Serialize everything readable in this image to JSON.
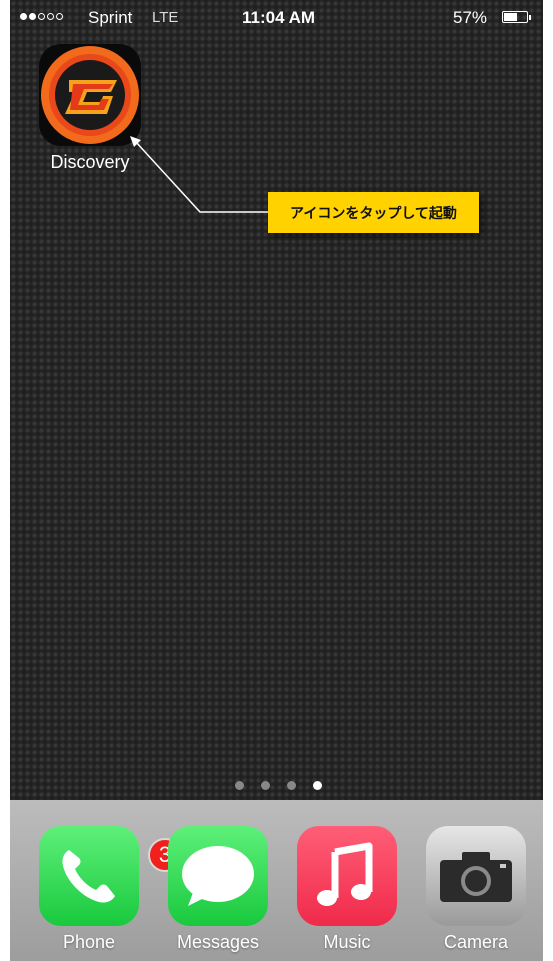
{
  "status_bar": {
    "signal_bars_filled": 2,
    "signal_bars_total": 5,
    "carrier": "Sprint",
    "network": "LTE",
    "time": "11:04 AM",
    "battery_percent_label": "57%",
    "battery_level": 0.57
  },
  "home": {
    "apps": [
      {
        "label": "Discovery",
        "icon": "discovery-app-icon"
      }
    ]
  },
  "callout": {
    "text": "アイコンをタップして起動",
    "background_color": "#ffd200"
  },
  "page_indicator": {
    "page_count": 4,
    "current_page": 4
  },
  "dock": {
    "apps": [
      {
        "label": "Phone",
        "icon": "phone-icon",
        "badge": "3"
      },
      {
        "label": "Messages",
        "icon": "messages-icon"
      },
      {
        "label": "Music",
        "icon": "music-note-icon"
      },
      {
        "label": "Camera",
        "icon": "camera-icon"
      }
    ]
  },
  "colors": {
    "badge_red": "#f0201c",
    "green_app": "#19c93d",
    "music_red": "#f02a4a"
  }
}
